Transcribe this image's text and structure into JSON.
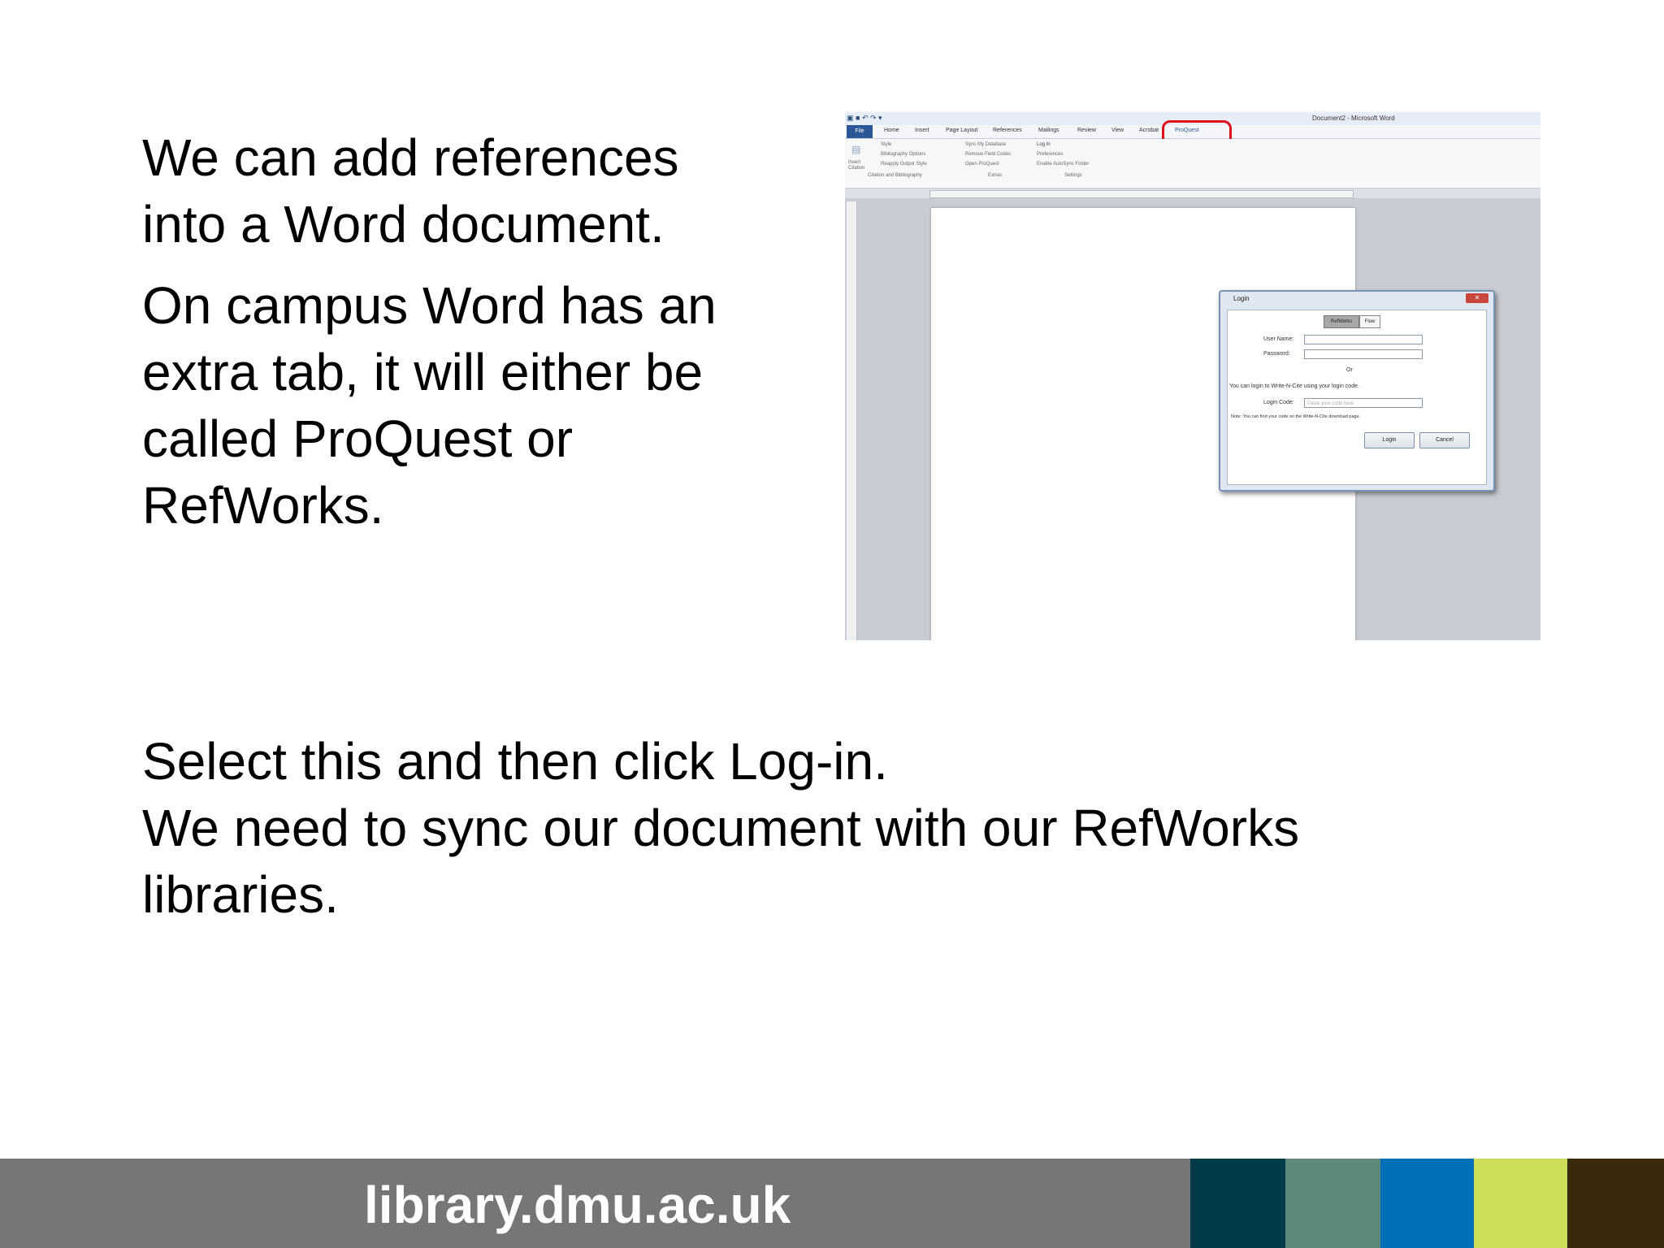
{
  "text": {
    "p1": [
      "We can add references",
      "into a Word document."
    ],
    "p2": [
      "On campus Word has an",
      "extra tab, it will either be",
      "called ProQuest or",
      "RefWorks."
    ],
    "p3": [
      "Select this and then click Log-in.",
      "We need to sync our document with our RefWorks",
      "libraries."
    ]
  },
  "word_screenshot": {
    "window_title": "Document2 - Microsoft Word",
    "tabs": [
      "File",
      "Home",
      "Insert",
      "Page Layout",
      "References",
      "Mailings",
      "Review",
      "View",
      "Acrobat",
      "ProQuest"
    ],
    "highlighted_tab": "ProQuest",
    "highlight_color": "#e0101a",
    "ribbon": {
      "citation_items": [
        "Style",
        "Bibliography Options",
        "Reapply Output Style"
      ],
      "insert_label": "Insert Citation",
      "group_citation": "Citation and Bibliography",
      "extras_items": [
        "Sync My Database",
        "Remove Field Codes",
        "Open ProQuest"
      ],
      "group_extras": "Extras",
      "settings_items": [
        "Log In",
        "Preferences",
        "Enable AutoSync Folder"
      ],
      "group_settings": "Settings"
    },
    "login_dialog": {
      "title": "Login",
      "tabs": [
        "RefWorks",
        "Flow"
      ],
      "user_name_label": "User Name:",
      "password_label": "Password:",
      "or_label": "Or",
      "info_text": "You can login to Write-N-Cite using your login code.",
      "login_code_label": "Login Code:",
      "login_code_placeholder": "Paste your code here",
      "note_text": "Note: You can find your code on the Write-N-Cite download page.",
      "login_button": "Login",
      "cancel_button": "Cancel"
    }
  },
  "footer": {
    "url": "library.dmu.ac.uk",
    "swatches": [
      "#003b47",
      "#5e8a7c",
      "#0070b8",
      "#cedd59",
      "#3a2a0c"
    ]
  }
}
